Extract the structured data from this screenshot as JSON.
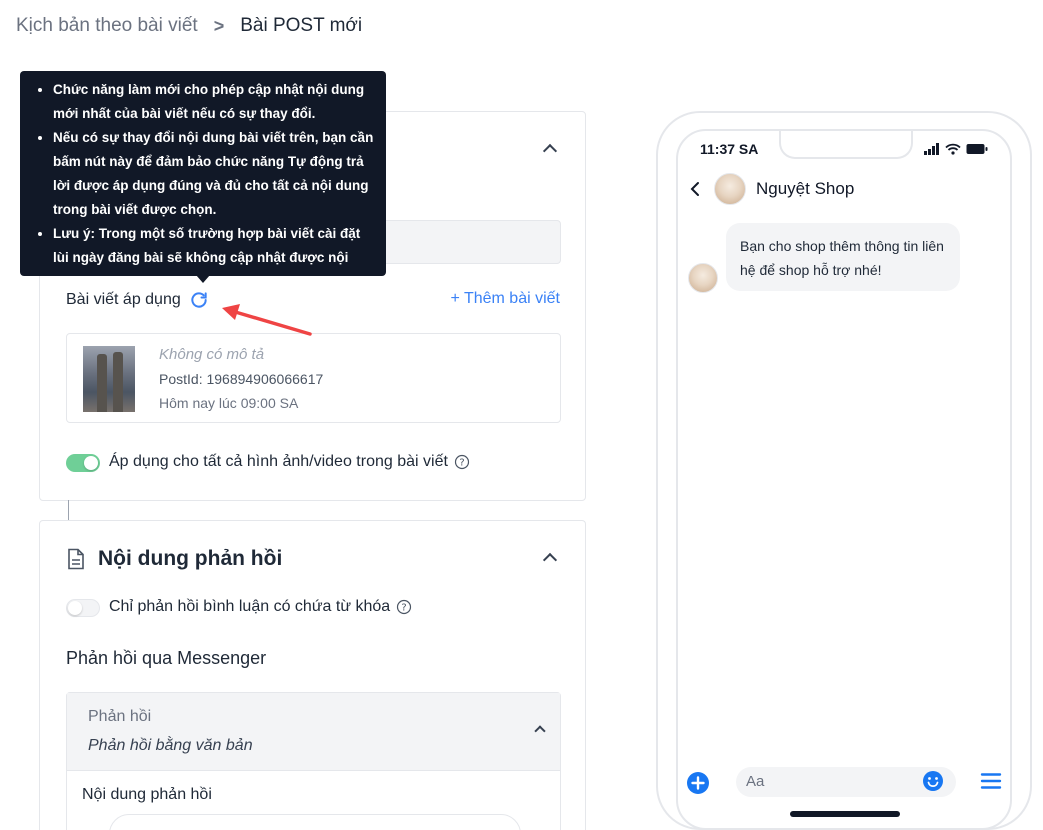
{
  "breadcrumb": {
    "parent": "Kịch bản theo bài viết",
    "separator": ">",
    "current": "Bài POST mới"
  },
  "tooltip": {
    "items": [
      "Chức năng làm mới cho phép cập nhật nội dung mới nhất của bài viết nếu có sự thay đổi.",
      "Nếu có sự thay đổi nội dung bài viết trên, bạn cần bấm nút này để đảm bảo chức năng Tự động trả lời được áp dụng đúng và đủ cho tất cả nội dung trong bài viết được chọn.",
      "Lưu ý: Trong một số trường hợp bài viết cài đặt lùi ngày đăng bài sẽ không cập nhật được nội dung."
    ]
  },
  "post_section": {
    "label": "Bài viết áp dụng",
    "add_link": "+ Thêm bài viết",
    "post": {
      "description": "Không có mô tả",
      "post_id": "PostId: 196894906066617",
      "time": "Hôm nay lúc 09:00 SA"
    },
    "apply_all_label": "Áp dụng cho tất cả hình ảnh/video trong bài viết",
    "apply_all_enabled": true
  },
  "reply_section": {
    "title": "Nội dung phản hồi",
    "keyword_only_label": "Chỉ phản hồi bình luận có chứa từ khóa",
    "keyword_only_enabled": false,
    "messenger_label": "Phản hồi qua Messenger",
    "reply_card": {
      "title": "Phản hồi",
      "subtitle": "Phản hồi bằng văn bản",
      "body_label": "Nội dung phản hồi"
    }
  },
  "phone_preview": {
    "status_time": "11:37 SA",
    "shop_name": "Nguyệt Shop",
    "message": "Bạn cho shop thêm thông tin liên hệ để shop hỗ trợ nhé!",
    "composer_placeholder": "Aa"
  },
  "colors": {
    "accent": "#3b82f6",
    "toggle_on": "#6fcf97",
    "tooltip_bg": "#111827",
    "messenger_blue": "#1877f2",
    "arrow_red": "#ef4444"
  }
}
